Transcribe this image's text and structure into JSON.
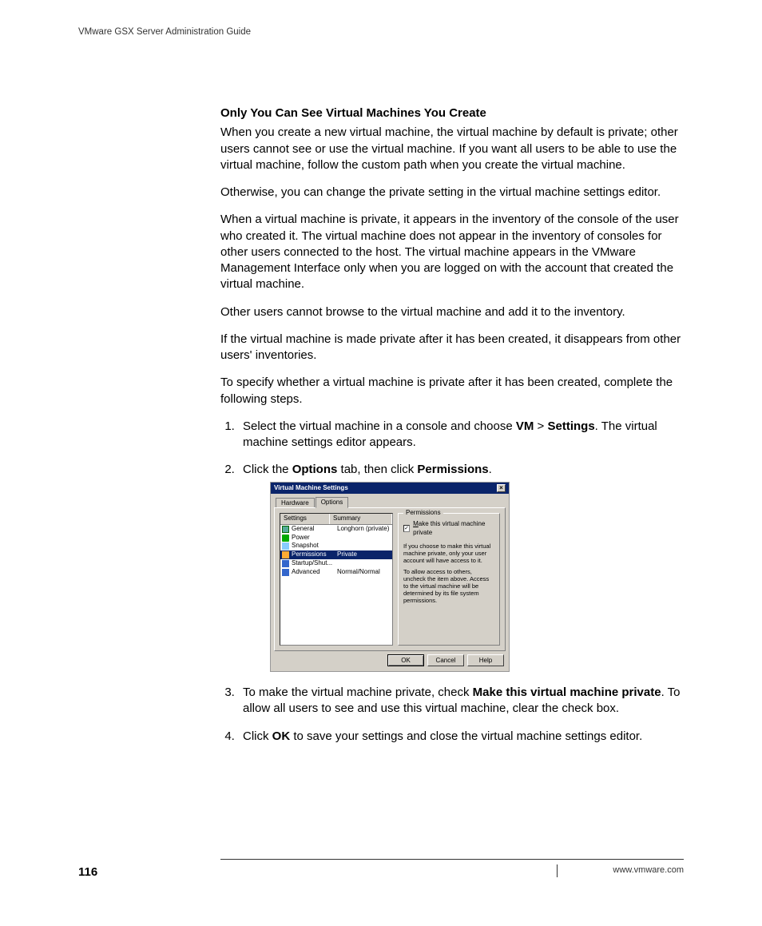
{
  "header": {
    "running_title": "VMware GSX Server Administration Guide"
  },
  "section": {
    "heading": "Only You Can See Virtual Machines You Create",
    "p1": "When you create a new virtual machine, the virtual machine by default is private; other users cannot see or use the virtual machine. If you want all users to be able to use the virtual machine, follow the custom path when you create the virtual machine.",
    "p2": "Otherwise, you can change the private setting in the virtual machine settings editor.",
    "p3": "When a virtual machine is private, it appears in the inventory of the console of the user who created it. The virtual machine does not appear in the inventory of consoles for other users connected to the host. The virtual machine appears in the VMware Management Interface only when you are logged on with the account that created the virtual machine.",
    "p4": "Other users cannot browse to the virtual machine and add it to the inventory.",
    "p5": "If the virtual machine is made private after it has been created, it disappears from other users' inventories.",
    "p6": "To specify whether a virtual machine is private after it has been created, complete the following steps."
  },
  "steps": {
    "s1_pre": "Select the virtual machine in a console and choose ",
    "s1_b1": "VM",
    "s1_sep": " > ",
    "s1_b2": "Settings",
    "s1_post": ". The virtual machine settings editor appears.",
    "s2_pre": "Click the ",
    "s2_b1": "Options",
    "s2_mid": " tab, then click ",
    "s2_b2": "Permissions",
    "s2_post": ".",
    "s3_pre": "To make the virtual machine private, check ",
    "s3_b1": "Make this virtual machine private",
    "s3_post": ". To allow all users to see and use this virtual machine, clear the check box.",
    "s4_pre": "Click ",
    "s4_b1": "OK",
    "s4_post": " to save your settings and close the virtual machine settings editor."
  },
  "dialog": {
    "title": "Virtual Machine Settings",
    "tabs": {
      "hardware": "Hardware",
      "options": "Options"
    },
    "columns": {
      "settings": "Settings",
      "summary": "Summary"
    },
    "rows": [
      {
        "icon": "ico-general",
        "name": "General",
        "summary": "Longhorn (private)",
        "selected": false
      },
      {
        "icon": "ico-power",
        "name": "Power",
        "summary": "",
        "selected": false
      },
      {
        "icon": "ico-snapshot",
        "name": "Snapshot",
        "summary": "",
        "selected": false
      },
      {
        "icon": "ico-permissions",
        "name": "Permissions",
        "summary": "Private",
        "selected": true
      },
      {
        "icon": "ico-startup",
        "name": "Startup/Shut...",
        "summary": "",
        "selected": false
      },
      {
        "icon": "ico-advanced",
        "name": "Advanced",
        "summary": "Normal/Normal",
        "selected": false
      }
    ],
    "group_label": "Permissions",
    "checkbox_checked": true,
    "checkbox_label_u": "M",
    "checkbox_label_rest": "ake this virtual machine private",
    "hint1": "If you choose to make this virtual machine private, only your user account will have access to it.",
    "hint2": "To allow access to others, uncheck the item above. Access to the virtual machine will be determined by its file system permissions.",
    "buttons": {
      "ok": "OK",
      "cancel": "Cancel",
      "help": "Help"
    }
  },
  "footer": {
    "page_number": "116",
    "url": "www.vmware.com"
  }
}
